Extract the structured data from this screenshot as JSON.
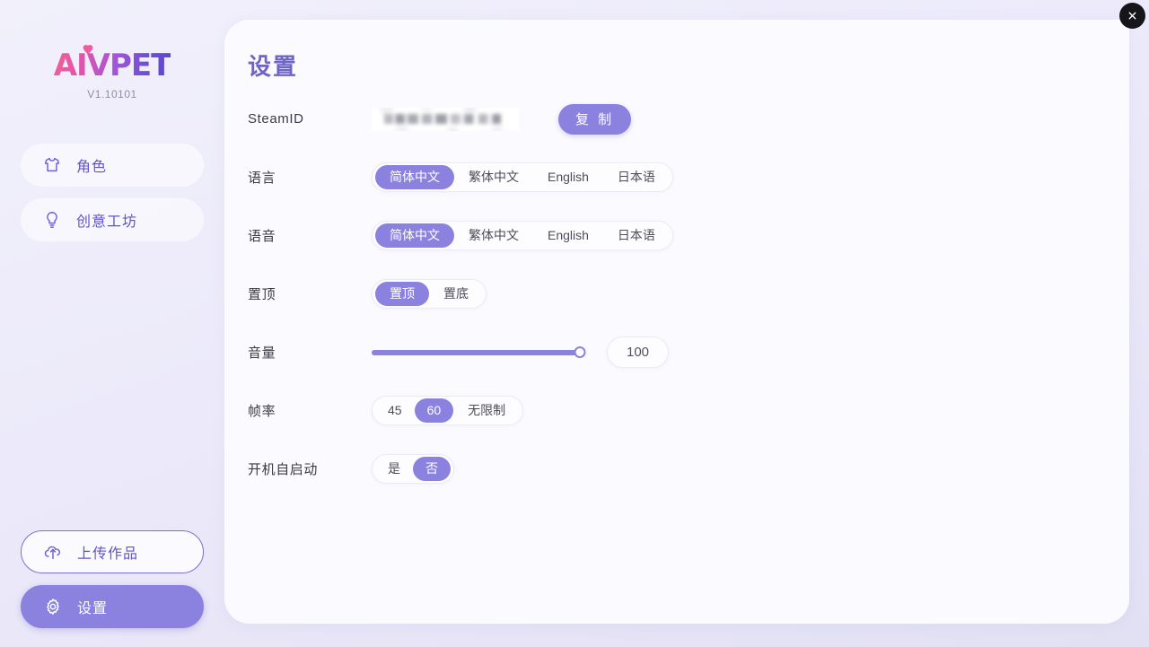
{
  "app": {
    "logo_text": "AIVPET",
    "version": "V1.10101",
    "logo_gradient_start": "#f0609a",
    "logo_gradient_end": "#5a46cf",
    "accent": "#8b82e0",
    "nav_text_color": "#5f55c9"
  },
  "window": {
    "close_label": "×"
  },
  "sidebar": {
    "top_items": [
      {
        "label": "角色",
        "icon": "tshirt-icon",
        "state": "plain"
      },
      {
        "label": "创意工坊",
        "icon": "lightbulb-icon",
        "state": "plain"
      }
    ],
    "bottom_items": [
      {
        "label": "上传作品",
        "icon": "cloud-upload-icon",
        "state": "outlined"
      },
      {
        "label": "设置",
        "icon": "gear-icon",
        "state": "active"
      }
    ]
  },
  "main": {
    "title": "设置",
    "rows": {
      "steam_id": {
        "label": "SteamID",
        "value": "",
        "redacted": true,
        "copy_label": "复 制"
      },
      "language": {
        "label": "语言",
        "options": [
          "简体中文",
          "繁体中文",
          "English",
          "日本语"
        ],
        "selected": "简体中文"
      },
      "voice": {
        "label": "语音",
        "options": [
          "简体中文",
          "繁体中文",
          "English",
          "日本语"
        ],
        "selected": "简体中文"
      },
      "pin": {
        "label": "置顶",
        "options": [
          "置顶",
          "置底"
        ],
        "selected": "置顶"
      },
      "volume": {
        "label": "音量",
        "value": "100",
        "percent": 100,
        "min": 0,
        "max": 100
      },
      "framerate": {
        "label": "帧率",
        "options": [
          "45",
          "60",
          "无限制"
        ],
        "selected": "60"
      },
      "autostart": {
        "label": "开机自启动",
        "options": [
          "是",
          "否"
        ],
        "selected": "否"
      }
    }
  }
}
